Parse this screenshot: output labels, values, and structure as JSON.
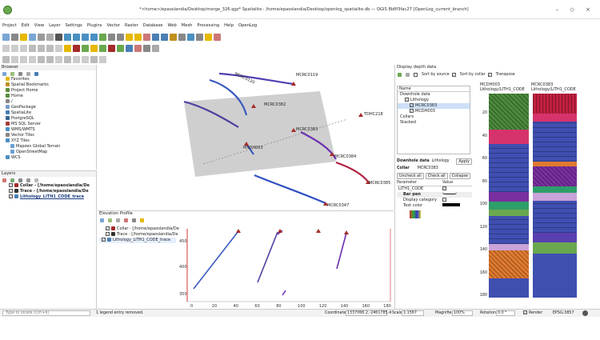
{
  "window": {
    "title": "*<home>/epaoslandia/Desktop/merge_326.qgz* Spatialite : /home/epaoslandia/Desktop/openlog_spatialite.db — QGIS 8b8f3fac27 [OpenLog_current_branch]",
    "controls": "– ◇ ×"
  },
  "menu": [
    "Project",
    "Edit",
    "View",
    "Layer",
    "Settings",
    "Plugins",
    "Vector",
    "Raster",
    "Database",
    "Web",
    "Mesh",
    "Processing",
    "Help",
    "OpenLog"
  ],
  "browser": {
    "title": "Browser",
    "items": [
      {
        "label": "Favorites",
        "icon": "star-icon",
        "color": "#e6b800"
      },
      {
        "label": "Spatial Bookmarks",
        "icon": "bookmark-icon",
        "color": "#c09020"
      },
      {
        "label": "Project Home",
        "icon": "folder-icon",
        "color": "#5a8f3c"
      },
      {
        "label": "Home",
        "icon": "home-icon",
        "color": "#5a8f3c"
      },
      {
        "label": "/",
        "icon": "drive-icon",
        "color": "#888888"
      },
      {
        "label": "GeoPackage",
        "icon": "geopackage-icon",
        "color": "#7a9cc6"
      },
      {
        "label": "SpatiaLite",
        "icon": "spatialite-icon",
        "color": "#4a7fb5"
      },
      {
        "label": "PostgreSQL",
        "icon": "postgres-icon",
        "color": "#336791"
      },
      {
        "label": "MS SQL Server",
        "icon": "mssql-icon",
        "color": "#a63a3a"
      },
      {
        "label": "WMS/WMTS",
        "icon": "wms-icon",
        "color": "#4a90c2"
      },
      {
        "label": "Vector Tiles",
        "icon": "vectortiles-icon",
        "color": "#888888"
      },
      {
        "label": "XYZ Tiles",
        "icon": "xyz-icon",
        "color": "#4a90c2"
      },
      {
        "label": "Mapzen Global Terrain",
        "icon": "tile-icon",
        "color": "#6aa0d0"
      },
      {
        "label": "OpenStreetMap",
        "icon": "tile-icon",
        "color": "#6aa0d0"
      },
      {
        "label": "WCS",
        "icon": "wcs-icon",
        "color": "#4a90c2"
      }
    ]
  },
  "layers": {
    "title": "Layers",
    "items": [
      {
        "label": "Collar - [/home/epaoslandia/De",
        "bold": true,
        "icon": "point-icon",
        "color": "#a52a2a",
        "underline": false
      },
      {
        "label": "Trace - [/home/epaoslandia/De",
        "bold": true,
        "icon": "line-icon",
        "color": "#333333",
        "underline": false
      },
      {
        "label": "Lithology_LITH1_CODE_trace",
        "bold": true,
        "icon": "line-icon",
        "color": "#4a7fb5",
        "underline": true
      }
    ]
  },
  "map": {
    "labels": [
      {
        "text": "MCRC0119"
      },
      {
        "text": "MCRC0382"
      },
      {
        "text": "MCRC0383"
      },
      {
        "text": "MCRC0384"
      },
      {
        "text": "MCRC0385"
      },
      {
        "text": "MCRC0347"
      },
      {
        "text": "MSDH003"
      },
      {
        "text": "TDHC218"
      },
      {
        "text": "MCRC0120"
      }
    ]
  },
  "profile": {
    "title": "Elevation Profile",
    "layers": [
      {
        "label": "Collar - [/home/epaoslandia/De"
      },
      {
        "label": "Trace - [/home/epaoslandia/De"
      },
      {
        "label": "Lithology_LITH1_CODE_trace"
      }
    ],
    "y_ticks": [
      "450",
      "400",
      "350"
    ],
    "x_ticks": [
      "0",
      "20",
      "40",
      "60",
      "80",
      "100",
      "120",
      "140",
      "160",
      "180"
    ]
  },
  "depth": {
    "title": "Display depth data",
    "toolbar": {
      "sort_source": "Sort by source",
      "sort_collar": "Sort by collar",
      "transpose": "Transpose"
    },
    "tree_header": "Name",
    "tree": [
      {
        "label": "Downhole data",
        "indent": 0
      },
      {
        "label": "Lithology",
        "indent": 1
      },
      {
        "label": "MCRC0383",
        "indent": 2,
        "selected": true
      },
      {
        "label": "MCDH003",
        "indent": 2
      },
      {
        "label": "Collars",
        "indent": 0
      },
      {
        "label": "Stacked",
        "indent": 0
      }
    ],
    "downhole_label": "Downhole data",
    "downhole_value": "Lithology",
    "apply": "Apply",
    "collar_label": "Collar",
    "collar_value": "MCRC0383",
    "uncheck_all": "Uncheck all",
    "check_all": "Check all",
    "collapse": "Collapse",
    "param_header": "Parameter",
    "value_header": "Value",
    "params": [
      {
        "label": "LITH1_CODE"
      },
      {
        "label": "Bar pen"
      },
      {
        "label": "Display category"
      },
      {
        "label": "Text color"
      }
    ],
    "col1_title": "MCDH003\nLithology/LITH1_CODE",
    "col1_l1": "MCDH003",
    "col1_l2": "Lithology/LITH1_CODE",
    "col2_l1": "MCRC0383",
    "col2_l2": "Lithology/LITH1_CODE",
    "depth_ticks": [
      "20",
      "40",
      "60",
      "80",
      "100",
      "120",
      "140",
      "160",
      "180"
    ]
  },
  "status": {
    "locate_placeholder": "Type to locate (Ctrl+K)",
    "message": "1 legend entry removed.",
    "coordinate_label": "Coordinate",
    "coordinate": "1337066.2,-2461785.4",
    "scale_label": "Scale",
    "scale": "1:1567",
    "magnifier_label": "Magnifier",
    "magnifier": "100%",
    "rotation_label": "Rotation",
    "rotation": "0.0 °",
    "render_label": "Render",
    "crs": "EPSG:3857"
  },
  "colors": {
    "accent": "#4a7fb5",
    "collar": "#a52a2a",
    "selected": "#cde0f7"
  }
}
